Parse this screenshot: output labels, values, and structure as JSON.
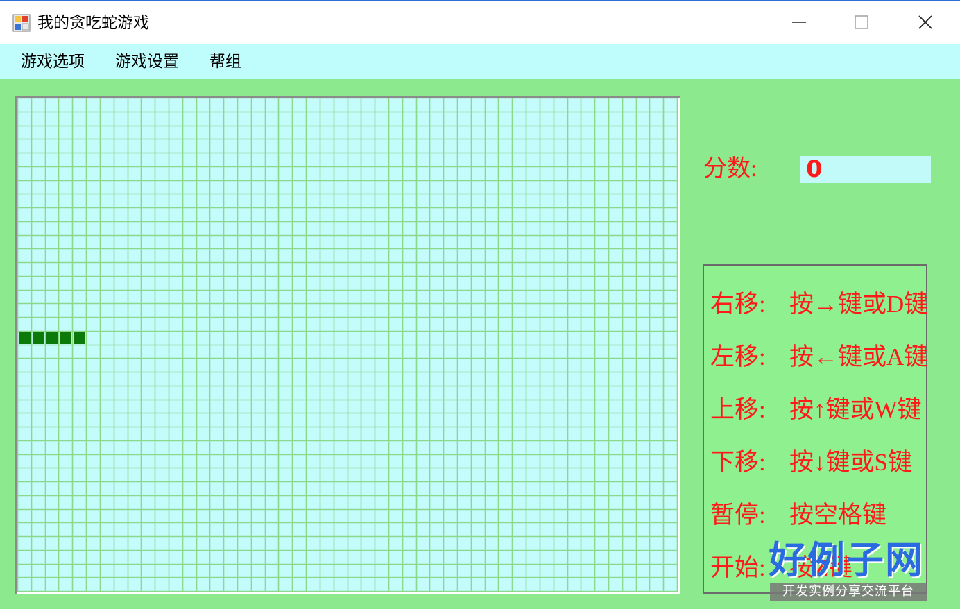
{
  "window": {
    "title": "我的贪吃蛇游戏"
  },
  "menu": [
    "游戏选项",
    "游戏设置",
    "帮组"
  ],
  "board": {
    "columns": 48,
    "rows": 36,
    "background": "#c4fbfb",
    "grid_color": "#8bd88b",
    "snake_color": "#0b7a0b",
    "snake_cells": [
      [
        0,
        17
      ],
      [
        1,
        17
      ],
      [
        2,
        17
      ],
      [
        3,
        17
      ],
      [
        4,
        17
      ]
    ]
  },
  "score": {
    "label": "分数:",
    "value": "0"
  },
  "help": [
    {
      "key": "右移:",
      "text": "按→键或D键"
    },
    {
      "key": "左移:",
      "text": "按←键或A键"
    },
    {
      "key": "上移:",
      "text": "按↑键或W键"
    },
    {
      "key": "下移:",
      "text": "按↓键或S键"
    },
    {
      "key": "暂停:",
      "text": "按空格键"
    },
    {
      "key": "开始:",
      "text": "按Z键"
    }
  ],
  "watermark": {
    "brand": "好例子网",
    "tagline": "开发实例分享交流平台"
  },
  "colors": {
    "accent_red": "#ff1a1a",
    "form_bg": "#8de98d",
    "menu_bg": "#bffdfd"
  }
}
